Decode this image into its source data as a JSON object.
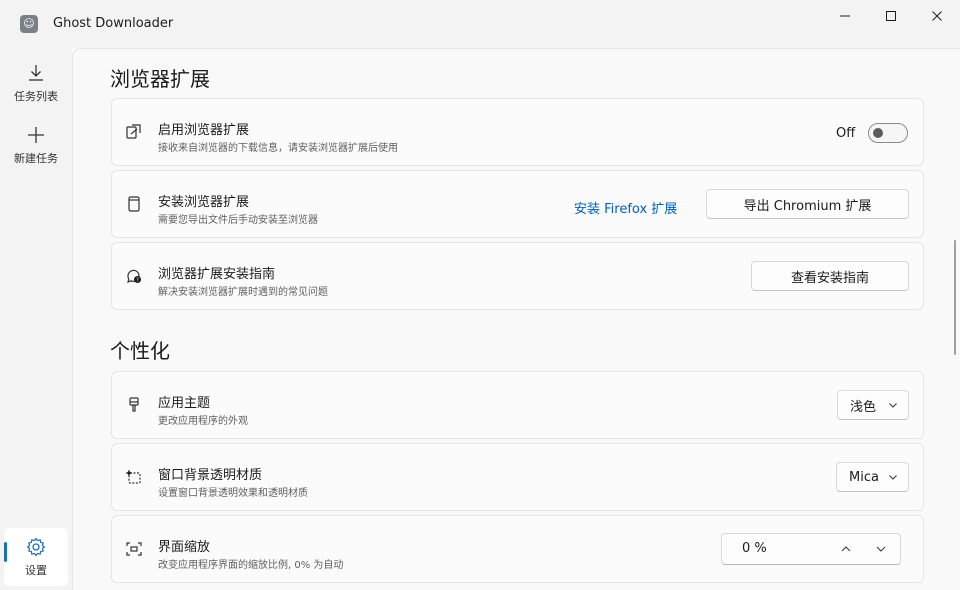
{
  "window": {
    "title": "Ghost Downloader"
  },
  "nav": {
    "items": [
      {
        "label": "任务列表",
        "icon": "download-icon"
      },
      {
        "label": "新建任务",
        "icon": "add-icon"
      }
    ],
    "settings": {
      "label": "设置",
      "icon": "gear-icon"
    }
  },
  "sections": {
    "browser": {
      "title": "浏览器扩展",
      "enable": {
        "title": "启用浏览器扩展",
        "desc": "接收来自浏览器的下载信息，请安装浏览器扩展后使用",
        "toggle_label": "Off"
      },
      "install": {
        "title": "安装浏览器扩展",
        "desc": "需要您导出文件后手动安装至浏览器",
        "firefox_link": "安装 Firefox 扩展",
        "chromium_button": "导出 Chromium 扩展"
      },
      "guide": {
        "title": "浏览器扩展安装指南",
        "desc": "解决安装浏览器扩展时遇到的常见问题",
        "button": "查看安装指南"
      }
    },
    "personalize": {
      "title": "个性化",
      "theme": {
        "title": "应用主题",
        "desc": "更改应用程序的外观",
        "value": "浅色"
      },
      "material": {
        "title": "窗口背景透明材质",
        "desc": "设置窗口背景透明效果和透明材质",
        "value": "Mica"
      },
      "scale": {
        "title": "界面缩放",
        "desc": "改变应用程序界面的缩放比例, 0% 为自动",
        "value": "0 %"
      }
    }
  },
  "colors": {
    "accent": "#005fb8",
    "nav_indicator": "#1f6fb5"
  }
}
